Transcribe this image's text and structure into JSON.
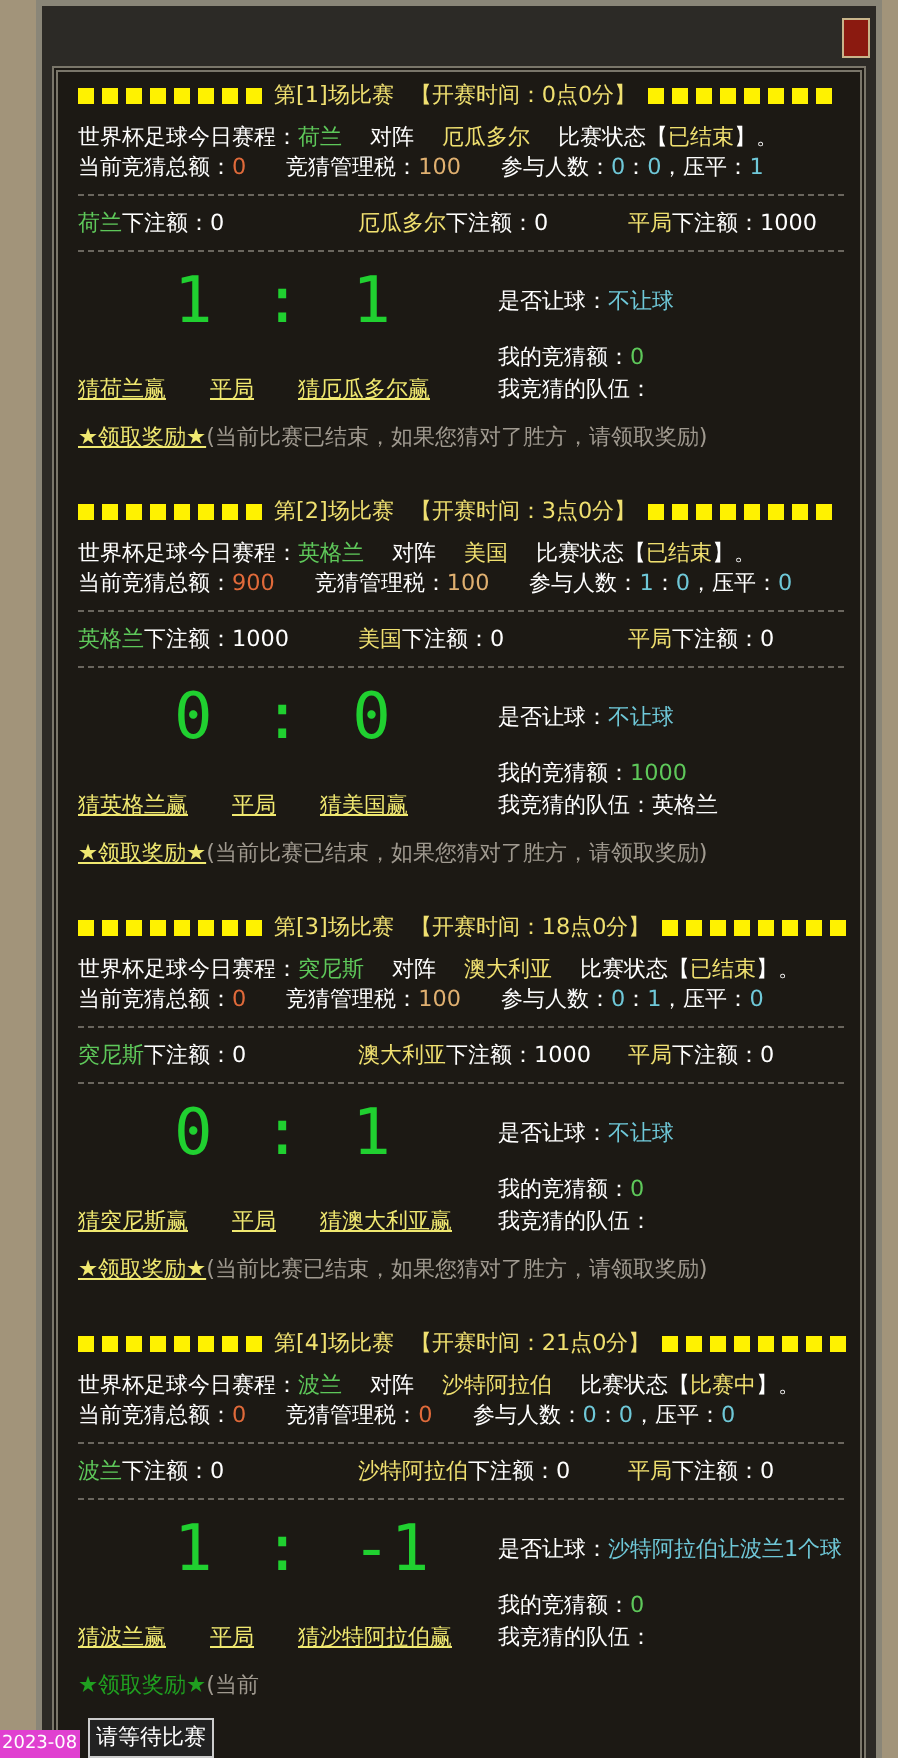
{
  "matches": [
    {
      "header": [
        {
          "text": "第[1]场比赛",
          "color": "#f0e070"
        },
        {
          "text": "【开赛时间：0点0分】",
          "color": "#f0e070"
        }
      ],
      "schedule": [
        {
          "text": "世界杯足球今日赛程：",
          "color": "#ffffff"
        },
        {
          "text": "荷兰",
          "color": "#5ec85a"
        },
        {
          "text": "对阵",
          "color": "#ffffff"
        },
        {
          "text": "厄瓜多尔",
          "color": "#f0e070"
        },
        {
          "text": "比赛状态【",
          "color": "#ffffff"
        },
        {
          "text": "已结束",
          "color": "#f0e070"
        },
        {
          "text": "】。",
          "color": "#ffffff"
        }
      ],
      "stats": [
        {
          "text": "当前竞猜总额：",
          "color": "#ffffff"
        },
        {
          "text": "0",
          "color": "#e06a3a"
        },
        {
          "text": "竞猜管理税：",
          "color": "#ffffff"
        },
        {
          "text": "100",
          "color": "#e0b070"
        },
        {
          "text": "参与人数：",
          "color": "#ffffff"
        },
        {
          "text": "0",
          "color": "#6fc8d8"
        },
        {
          "text": "：",
          "color": "#ffffff"
        },
        {
          "text": "0",
          "color": "#6fc8d8"
        },
        {
          "text": "，压平：",
          "color": "#ffffff"
        },
        {
          "text": "1",
          "color": "#6fc8d8"
        }
      ],
      "bets": [
        {
          "team": "荷兰",
          "color": "#5ec85a",
          "label": "下注额：",
          "amount": "0"
        },
        {
          "team": "厄瓜多尔",
          "color": "#f0e070",
          "label": "下注额：",
          "amount": "0"
        },
        {
          "team": "平局",
          "color": "#f0e070",
          "label": "下注额：",
          "amount": "1000"
        }
      ],
      "score": "1 : 1",
      "handicap": {
        "label": "是否让球：",
        "value": "不让球"
      },
      "my_bet": {
        "label": "我的竞猜额：",
        "value": "0"
      },
      "my_team": {
        "label": "我竞猜的队伍："
      },
      "guesses": [
        "猜荷兰赢",
        "平局",
        "猜厄瓜多尔赢"
      ],
      "reward": {
        "label": "★领取奖励★",
        "enabled": true,
        "note": "(当前比赛已结束，如果您猜对了胜方，请领取奖励)"
      }
    },
    {
      "header": [
        {
          "text": "第[2]场比赛",
          "color": "#f0e070"
        },
        {
          "text": "【开赛时间：3点0分】",
          "color": "#f0e070"
        }
      ],
      "schedule": [
        {
          "text": "世界杯足球今日赛程：",
          "color": "#ffffff"
        },
        {
          "text": "英格兰",
          "color": "#5ec85a"
        },
        {
          "text": "对阵",
          "color": "#ffffff"
        },
        {
          "text": "美国",
          "color": "#f0e070"
        },
        {
          "text": "比赛状态【",
          "color": "#ffffff"
        },
        {
          "text": "已结束",
          "color": "#f0e070"
        },
        {
          "text": "】。",
          "color": "#ffffff"
        }
      ],
      "stats": [
        {
          "text": "当前竞猜总额：",
          "color": "#ffffff"
        },
        {
          "text": "900",
          "color": "#e06a3a"
        },
        {
          "text": "竞猜管理税：",
          "color": "#ffffff"
        },
        {
          "text": "100",
          "color": "#e0b070"
        },
        {
          "text": "参与人数：",
          "color": "#ffffff"
        },
        {
          "text": "1",
          "color": "#6fc8d8"
        },
        {
          "text": "：",
          "color": "#ffffff"
        },
        {
          "text": "0",
          "color": "#6fc8d8"
        },
        {
          "text": "，压平：",
          "color": "#ffffff"
        },
        {
          "text": "0",
          "color": "#6fc8d8"
        }
      ],
      "bets": [
        {
          "team": "英格兰",
          "color": "#5ec85a",
          "label": "下注额：",
          "amount": "1000"
        },
        {
          "team": "美国",
          "color": "#f0e070",
          "label": "下注额：",
          "amount": "0"
        },
        {
          "team": "平局",
          "color": "#f0e070",
          "label": "下注额：",
          "amount": "0"
        }
      ],
      "score": "0 : 0",
      "handicap": {
        "label": "是否让球：",
        "value": "不让球"
      },
      "my_bet": {
        "label": "我的竞猜额：",
        "value": "1000"
      },
      "my_team": {
        "label": "我竞猜的队伍：",
        "value": "英格兰"
      },
      "guesses": [
        "猜英格兰赢",
        "平局",
        "猜美国赢"
      ],
      "reward": {
        "label": "★领取奖励★",
        "enabled": true,
        "note": "(当前比赛已结束，如果您猜对了胜方，请领取奖励)"
      }
    },
    {
      "header": [
        {
          "text": "第[3]场比赛",
          "color": "#f0e070"
        },
        {
          "text": "【开赛时间：18点0分】",
          "color": "#f0e070"
        }
      ],
      "schedule": [
        {
          "text": "世界杯足球今日赛程：",
          "color": "#ffffff"
        },
        {
          "text": "突尼斯",
          "color": "#5ec85a"
        },
        {
          "text": "对阵",
          "color": "#ffffff"
        },
        {
          "text": "澳大利亚",
          "color": "#f0e070"
        },
        {
          "text": "比赛状态【",
          "color": "#ffffff"
        },
        {
          "text": "已结束",
          "color": "#f0e070"
        },
        {
          "text": "】。",
          "color": "#ffffff"
        }
      ],
      "stats": [
        {
          "text": "当前竞猜总额：",
          "color": "#ffffff"
        },
        {
          "text": "0",
          "color": "#e06a3a"
        },
        {
          "text": "竞猜管理税：",
          "color": "#ffffff"
        },
        {
          "text": "100",
          "color": "#e0b070"
        },
        {
          "text": "参与人数：",
          "color": "#ffffff"
        },
        {
          "text": "0",
          "color": "#6fc8d8"
        },
        {
          "text": "：",
          "color": "#ffffff"
        },
        {
          "text": "1",
          "color": "#6fc8d8"
        },
        {
          "text": "，压平：",
          "color": "#ffffff"
        },
        {
          "text": "0",
          "color": "#6fc8d8"
        }
      ],
      "bets": [
        {
          "team": "突尼斯",
          "color": "#5ec85a",
          "label": "下注额：",
          "amount": "0"
        },
        {
          "team": "澳大利亚",
          "color": "#f0e070",
          "label": "下注额：",
          "amount": "1000"
        },
        {
          "team": "平局",
          "color": "#f0e070",
          "label": "下注额：",
          "amount": "0"
        }
      ],
      "score": "0 : 1",
      "handicap": {
        "label": "是否让球：",
        "value": "不让球"
      },
      "my_bet": {
        "label": "我的竞猜额：",
        "value": "0"
      },
      "my_team": {
        "label": "我竞猜的队伍："
      },
      "guesses": [
        "猜突尼斯赢",
        "平局",
        "猜澳大利亚赢"
      ],
      "reward": {
        "label": "★领取奖励★",
        "enabled": true,
        "note": "(当前比赛已结束，如果您猜对了胜方，请领取奖励)"
      }
    },
    {
      "header": [
        {
          "text": "第[4]场比赛",
          "color": "#f0e070"
        },
        {
          "text": "【开赛时间：21点0分】",
          "color": "#f0e070"
        }
      ],
      "schedule": [
        {
          "text": "世界杯足球今日赛程：",
          "color": "#ffffff"
        },
        {
          "text": "波兰",
          "color": "#5ec85a"
        },
        {
          "text": "对阵",
          "color": "#ffffff"
        },
        {
          "text": "沙特阿拉伯",
          "color": "#f0e070"
        },
        {
          "text": "比赛状态【",
          "color": "#ffffff"
        },
        {
          "text": "比赛中",
          "color": "#f0e070"
        },
        {
          "text": "】。",
          "color": "#ffffff"
        }
      ],
      "stats": [
        {
          "text": "当前竞猜总额：",
          "color": "#ffffff"
        },
        {
          "text": "0",
          "color": "#e06a3a"
        },
        {
          "text": "竞猜管理税：",
          "color": "#ffffff"
        },
        {
          "text": "0",
          "color": "#e06a3a"
        },
        {
          "text": "参与人数：",
          "color": "#ffffff"
        },
        {
          "text": "0",
          "color": "#6fc8d8"
        },
        {
          "text": "：",
          "color": "#ffffff"
        },
        {
          "text": "0",
          "color": "#6fc8d8"
        },
        {
          "text": "，压平：",
          "color": "#ffffff"
        },
        {
          "text": "0",
          "color": "#6fc8d8"
        }
      ],
      "bets": [
        {
          "team": "波兰",
          "color": "#5ec85a",
          "label": "下注额：",
          "amount": "0"
        },
        {
          "team": "沙特阿拉伯",
          "color": "#f0e070",
          "label": "下注额：",
          "amount": "0"
        },
        {
          "team": "平局",
          "color": "#f0e070",
          "label": "下注额：",
          "amount": "0"
        }
      ],
      "score": "1 : -1",
      "handicap": {
        "label": "是否让球：",
        "value": "沙特阿拉伯让波兰1个球"
      },
      "my_bet": {
        "label": "我的竞猜额：",
        "value": "0"
      },
      "my_team": {
        "label": "我竞猜的队伍："
      },
      "guesses": [
        "猜波兰赢",
        "平局",
        "猜沙特阿拉伯赢"
      ],
      "reward": {
        "label": "★领取奖励★",
        "enabled": false,
        "note": "(当前"
      }
    }
  ],
  "timestamp": "2023-08",
  "tooltip": "请等待比赛"
}
